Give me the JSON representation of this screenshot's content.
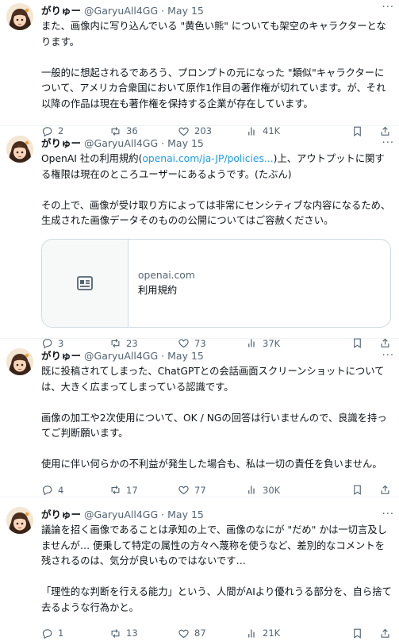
{
  "author": {
    "name": "がりゅー",
    "handle": "@GaryuAll4GG",
    "separator": "·",
    "more": "···"
  },
  "tweets": [
    {
      "date": "May 15",
      "paragraphs": [
        [
          "また、画像内に写り込んでいる \"黄色い熊\" についても架空のキャラクターとなります。"
        ],
        [
          "一般的に想起されるであろう、プロンプトの元になった \"類似\"キャラクターについて、アメリカ合衆国において原作1作目の著作権が切れています。が、それ以降の作品は現在も著作権を保持する企業が存在しています。"
        ]
      ],
      "replies": "2",
      "retweets": "36",
      "likes": "203",
      "views": "41K"
    },
    {
      "date": "May 15",
      "line1_pre": "OpenAI 社の利用規約(",
      "line1_link": "openai.com/ja-JP/policies...",
      "line1_post": ")上、アウトプットに関する権限は現在のところユーザーにあるようです。(たぶん)",
      "paragraph2": "その上で、画像が受け取り方によっては非常にセンシティブな内容になるため、生成された画像データそのものの公開についてはご容赦ください。",
      "card": {
        "domain": "openai.com",
        "title": "利用規約",
        "icon": "article-icon"
      },
      "replies": "3",
      "retweets": "23",
      "likes": "73",
      "views": "37K"
    },
    {
      "date": "May 15",
      "paragraphs": [
        [
          "既に投稿されてしまった、ChatGPTとの会話画面スクリーンショットについては、大きく広まってしまっている認識です。"
        ],
        [
          "画像の加工や2次使用について、OK / NGの回答は行いませんので、良識を持ってご判断願います。"
        ],
        [
          "使用に伴い何らかの不利益が発生した場合も、私は一切の責任を負いません。"
        ]
      ],
      "replies": "4",
      "retweets": "17",
      "likes": "77",
      "views": "30K"
    },
    {
      "date": "May 15",
      "paragraphs": [
        [
          "議論を招く画像であることは承知の上で、画像のなにが \"だめ\" かは一切言及しませんが… 便乗して特定の属性の方々へ蔑称を使うなど、差別的なコメントを残されるのは、気分が良いものではないです…"
        ],
        [
          "「理性的な判断を行える能力」という、人間がAIより優れうる部分を、自ら捨て去るような行為かと。"
        ]
      ],
      "replies": "1",
      "retweets": "13",
      "likes": "87",
      "views": "21K"
    }
  ],
  "icons": [
    "reply-icon",
    "retweet-icon",
    "like-icon",
    "views-icon",
    "bookmark-icon",
    "share-icon"
  ],
  "colors": {
    "link": "#1d9bf0",
    "muted": "#536471",
    "text": "#0f1419",
    "border": "#cfd9de"
  }
}
